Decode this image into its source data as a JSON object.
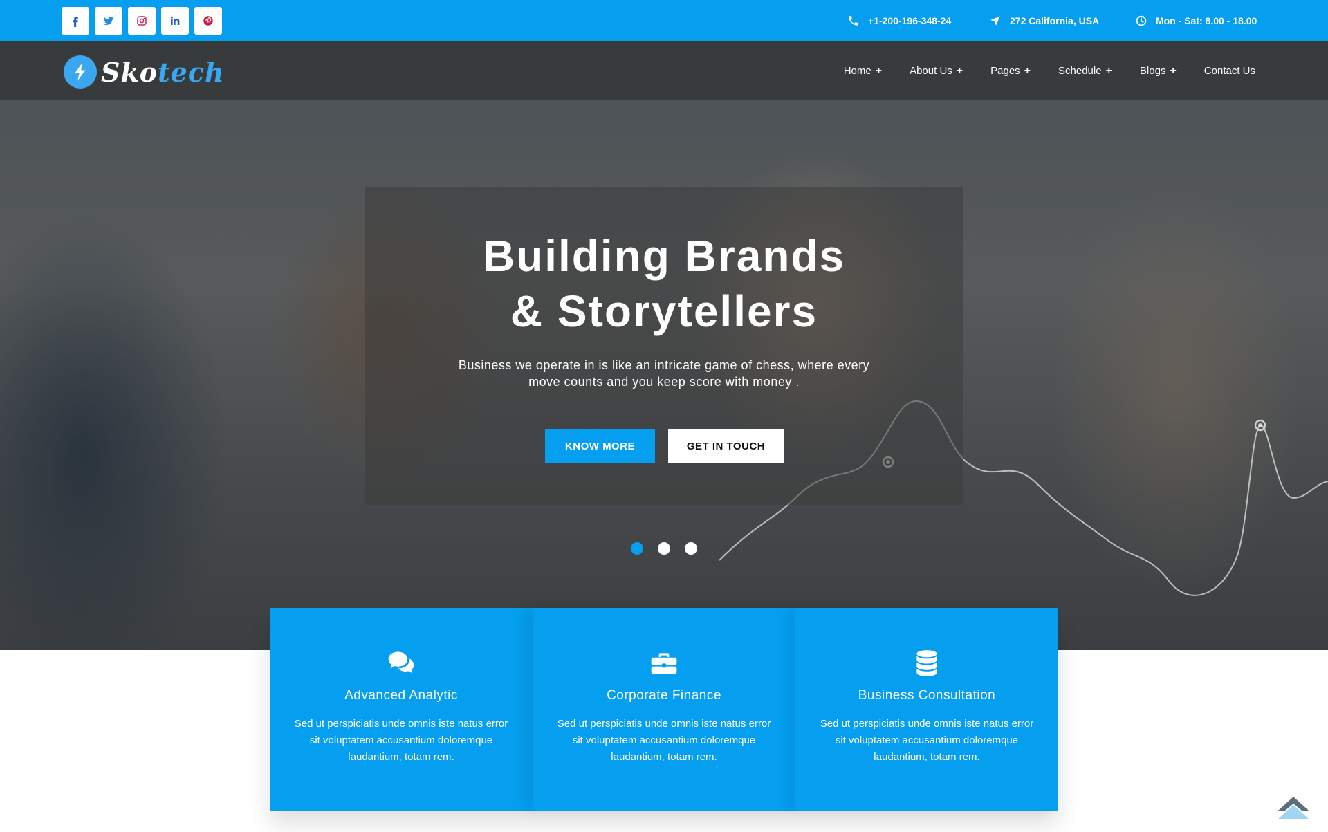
{
  "topbar": {
    "socials": [
      {
        "icon": "facebook-icon"
      },
      {
        "icon": "twitter-icon"
      },
      {
        "icon": "instagram-icon"
      },
      {
        "icon": "linkedin-icon"
      },
      {
        "icon": "pinterest-icon"
      }
    ],
    "phone": "+1-200-196-348-24",
    "address": "272 California, USA",
    "hours": "Mon - Sat: 8.00 - 18.00"
  },
  "brand": {
    "part1": "Sko",
    "part2": "tech"
  },
  "nav": {
    "items": [
      "Home",
      "About Us",
      "Pages",
      "Schedule",
      "Blogs",
      "Contact Us"
    ]
  },
  "hero": {
    "title_line1": "Building Brands",
    "title_line2": "& Storytellers",
    "subtitle": "Business we operate in is like an intricate game of chess, where every move counts and you keep score with money .",
    "primary_button": "KNOW MORE",
    "secondary_button": "GET IN TOUCH",
    "slides_total": 3,
    "active_slide": 1
  },
  "features": [
    {
      "icon": "comments-icon",
      "title": "Advanced Analytic",
      "text": "Sed ut perspiciatis unde omnis iste natus error sit voluptatem accusantium doloremque laudantium, totam rem."
    },
    {
      "icon": "briefcase-icon",
      "title": "Corporate Finance",
      "text": "Sed ut perspiciatis unde omnis iste natus error sit voluptatem accusantium doloremque laudantium, totam rem."
    },
    {
      "icon": "database-icon",
      "title": "Business Consultation",
      "text": "Sed ut perspiciatis unde omnis iste natus error sit voluptatem accusantium doloremque laudantium, totam rem."
    }
  ],
  "colors": {
    "accent": "#069ff0",
    "brand_blue": "#3aa7f0"
  }
}
